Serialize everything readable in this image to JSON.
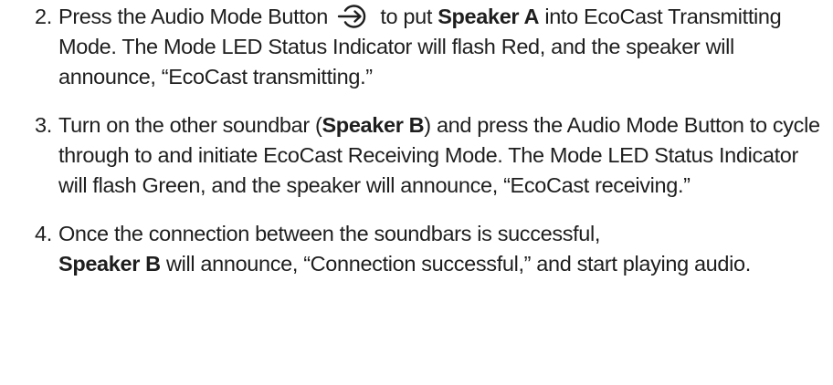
{
  "steps": [
    {
      "number": "2.",
      "parts": {
        "a": "Press the Audio Mode Button",
        "b": "to put",
        "c": "Speaker A",
        "d": "into EcoCast Transmitting Mode. The Mode LED Status Indicator will flash Red, and the speaker will announce, “EcoCast transmitting.”"
      },
      "icon": "audio-mode-arrow-icon"
    },
    {
      "number": "3.",
      "parts": {
        "a": "Turn on the other soundbar (",
        "b": "Speaker B",
        "c": ") and press the Audio Mode Button to cycle through to and initiate EcoCast Receiving Mode. The Mode LED Status Indicator will flash Green, and the speaker will announce, “EcoCast receiving.”"
      }
    },
    {
      "number": "4.",
      "parts": {
        "a": "Once the connection between the soundbars is successful,",
        "b": "Speaker B",
        "c": "will announce, “Connection successful,” and start playing audio."
      }
    }
  ]
}
